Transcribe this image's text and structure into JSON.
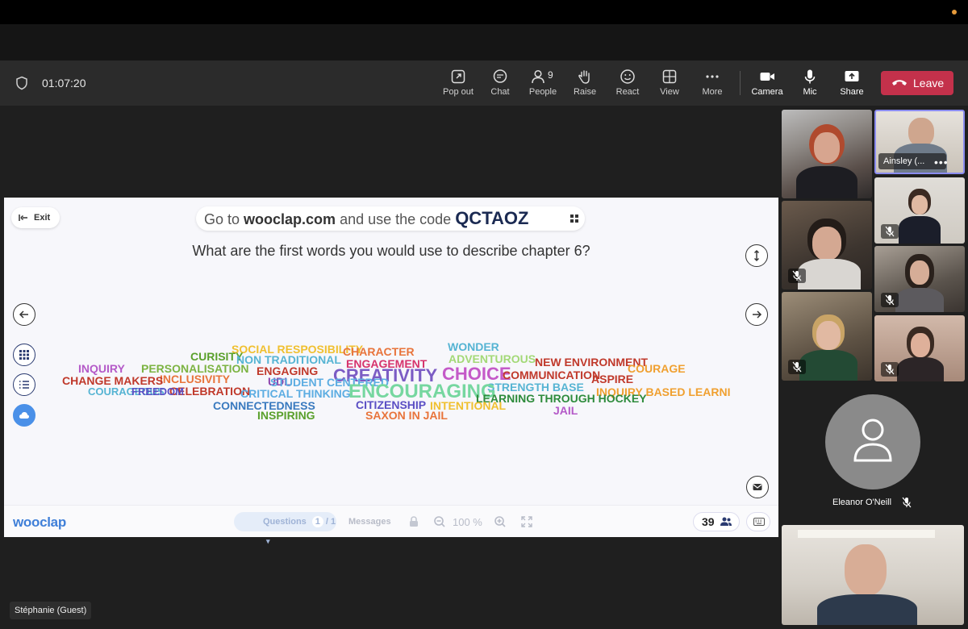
{
  "meeting": {
    "timer": "01:07:20",
    "toolbar": {
      "pop_out": "Pop out",
      "chat": "Chat",
      "people": "People",
      "people_count": "9",
      "raise": "Raise",
      "react": "React",
      "view": "View",
      "more": "More",
      "camera": "Camera",
      "mic": "Mic",
      "share": "Share",
      "leave": "Leave"
    },
    "participants": {
      "pinned_name": "Ainsley (...",
      "avatar_name": "Eleanor O'Neill",
      "guest_name": "Stéphanie (Guest)"
    }
  },
  "wooclap": {
    "exit": "Exit",
    "code_prefix": "Go to ",
    "code_site": "wooclap.com",
    "code_mid": " and use the code ",
    "code": "QCTAOZ",
    "question": "What are the first words you would use to describe chapter 6?",
    "logo": "wooclap",
    "questions_tab": "Questions",
    "question_index": "1",
    "question_total": "/ 1",
    "messages_tab": "Messages",
    "zoom": "100 %",
    "participant_count": "39"
  },
  "word_cloud": [
    {
      "text": "SOCIAL RESPOSIBILITY",
      "color": "#f0c030"
    },
    {
      "text": "CHARACTER",
      "color": "#e8743b"
    },
    {
      "text": "WONDER",
      "color": "#56b4d3"
    },
    {
      "text": "CURISITY",
      "color": "#5aa02c"
    },
    {
      "text": "NON TRADITIONAL",
      "color": "#56b4d3"
    },
    {
      "text": "ENGAGEMENT",
      "color": "#d6336c"
    },
    {
      "text": "ADVENTUROUS",
      "color": "#a3d977"
    },
    {
      "text": "NEW ENVIRONMENT",
      "color": "#c0392b"
    },
    {
      "text": "INQUIRY",
      "color": "#b45ac8"
    },
    {
      "text": "PERSONALISATION",
      "color": "#7cb342"
    },
    {
      "text": "ENGAGING",
      "color": "#c0392b"
    },
    {
      "text": "COURAGE",
      "color": "#f0a030"
    },
    {
      "text": "CREATIVITY",
      "color": "#7b5cc4"
    },
    {
      "text": "CHOICE",
      "color": "#c45ac8"
    },
    {
      "text": "COMMUNICATION",
      "color": "#c0392b"
    },
    {
      "text": "INCLUSIVITY",
      "color": "#e8743b"
    },
    {
      "text": "ASPIRE",
      "color": "#c0392b"
    },
    {
      "text": "CHANGE MAKERS",
      "color": "#c0392b"
    },
    {
      "text": "UDL",
      "color": "#8e44ad"
    },
    {
      "text": "STUDENT CENTERED",
      "color": "#5dade2"
    },
    {
      "text": "STRENGTH BASE",
      "color": "#56b4d3"
    },
    {
      "text": "CELEBRATION",
      "color": "#c0392b"
    },
    {
      "text": "COURAGEOUS",
      "color": "#56b4d3"
    },
    {
      "text": "FREEDOM",
      "color": "#5b4fc4"
    },
    {
      "text": "CRITICAL THINKING",
      "color": "#5dade2"
    },
    {
      "text": "ENCOURAGING",
      "color": "#76d7a0"
    },
    {
      "text": "INQUIRY BASED LEARNI",
      "color": "#f0a030"
    },
    {
      "text": "LEARNING THROUGH HOCKEY",
      "color": "#2e8b3c"
    },
    {
      "text": "CITIZENSHIP",
      "color": "#5b4fc4"
    },
    {
      "text": "CONNECTEDNESS",
      "color": "#3a7abf"
    },
    {
      "text": "INTENTIONAL",
      "color": "#f0c030"
    },
    {
      "text": "JAIL",
      "color": "#b45ac8"
    },
    {
      "text": "INSPIRING",
      "color": "#5aa02c"
    },
    {
      "text": "SAXON IN JAIL",
      "color": "#e8743b"
    }
  ]
}
